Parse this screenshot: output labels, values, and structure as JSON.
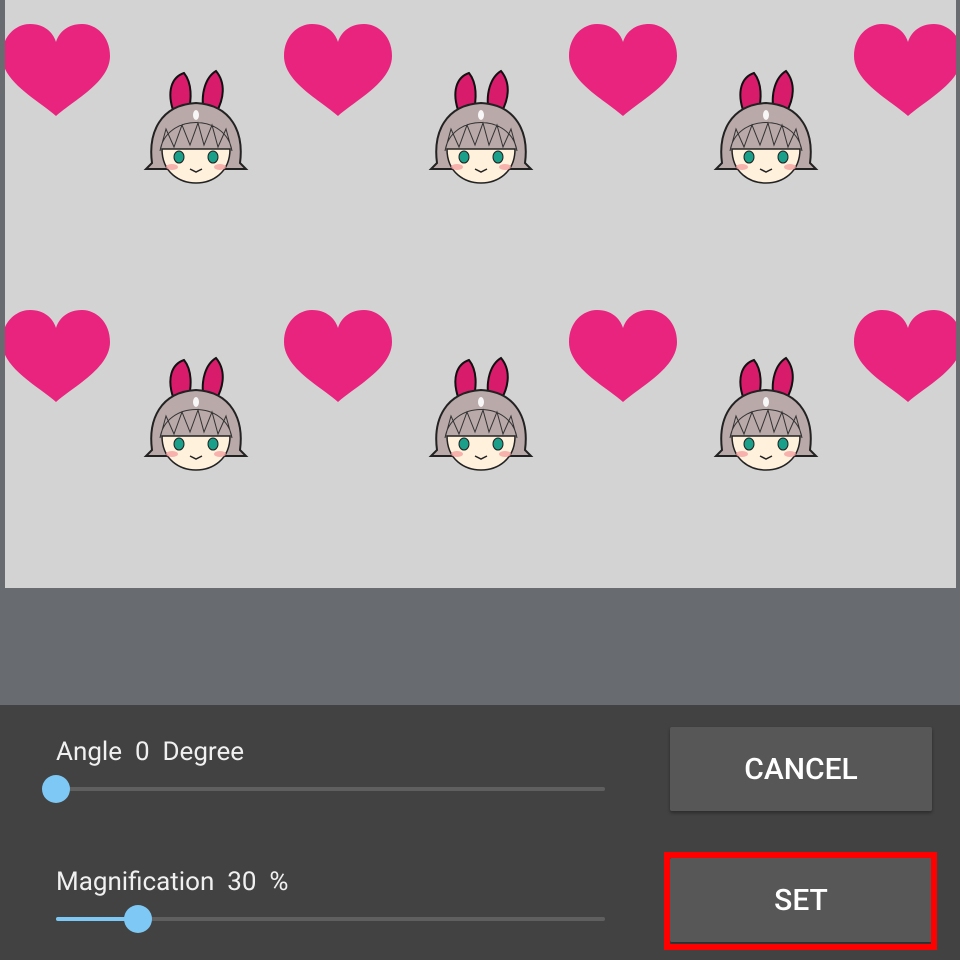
{
  "pattern": {
    "background_color": "#d3d3d3",
    "heart_color": "#e8247f",
    "tile_icons": [
      "heart-icon",
      "bunny-girl-icon"
    ]
  },
  "angle": {
    "label": "Angle",
    "value": "0",
    "unit": "Degree",
    "value_fraction": 0.0
  },
  "magnification": {
    "label": "Magnification",
    "value": "30",
    "unit": "%",
    "value_fraction": 0.15
  },
  "buttons": {
    "cancel_label": "CANCEL",
    "set_label": "SET"
  },
  "accent_color": "#7dc8f4",
  "highlight_color": "#ff0000"
}
